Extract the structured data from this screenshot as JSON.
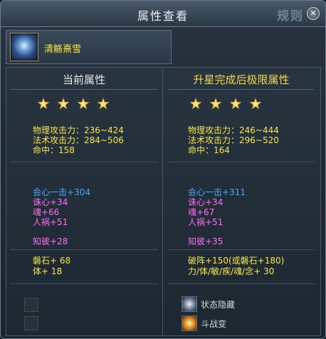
{
  "window": {
    "title": "属性查看",
    "rules_label": "规则"
  },
  "item": {
    "name": "清觞熹雪",
    "icon": "sword-item-icon"
  },
  "left": {
    "header": "当前属性",
    "stars": 4,
    "base": [
      "物理攻击力：236~424",
      "法术攻击力：284~506",
      "命中：158"
    ],
    "mods_blue": [
      "会心一击+304"
    ],
    "mods_pink": [
      "诛心+34",
      "魂+66",
      "人祸+51"
    ],
    "mods_pink2": [
      "知彼+28"
    ],
    "extra": [
      "磐石+ 68",
      "体+ 18"
    ]
  },
  "right": {
    "header": "升星完成后极限属性",
    "stars": 4,
    "base": [
      "物理攻击力：246~444",
      "法术攻击力：296~520",
      "命中：164"
    ],
    "mods_blue": [
      "会心一击+311"
    ],
    "mods_pink": [
      "诛心+34",
      "魂+67",
      "人祸+51"
    ],
    "mods_pink2": [
      "知彼+35"
    ],
    "extra": [
      "破阵+150(或磐石+180)",
      "力/体/敏/疾/魂/念+ 30"
    ]
  },
  "bottom": {
    "status_hidden_label": "状态隐藏",
    "battle_change_label": "斗战变"
  },
  "colors": {
    "yellow": "#f7e64a",
    "blue": "#4aa8ff",
    "pink": "#ff6ef5"
  }
}
